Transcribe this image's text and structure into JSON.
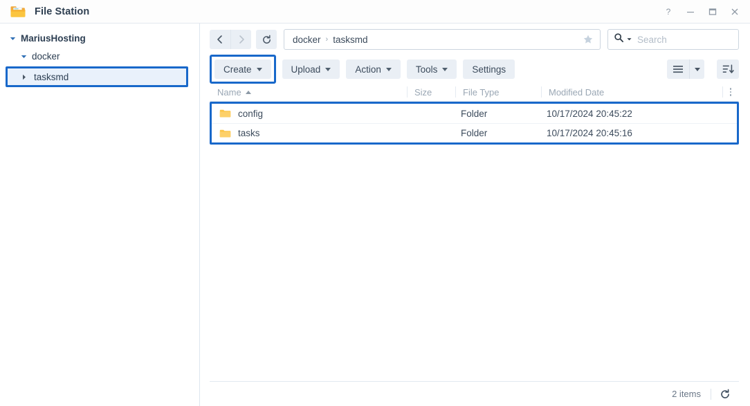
{
  "window": {
    "title": "File Station",
    "icon": "folder-icon",
    "controls": [
      {
        "name": "help-button",
        "glyph": "?"
      },
      {
        "name": "minimize-button",
        "glyph": "—"
      },
      {
        "name": "maximize-button",
        "glyph": "☐"
      },
      {
        "name": "close-button",
        "glyph": "✕"
      }
    ]
  },
  "sidebar": {
    "items": [
      {
        "label": "MariusHosting",
        "level": 0,
        "expanded": true,
        "selected": false
      },
      {
        "label": "docker",
        "level": 1,
        "expanded": true,
        "selected": false
      },
      {
        "label": "tasksmd",
        "level": 2,
        "expanded": false,
        "selected": true
      }
    ]
  },
  "navbar": {
    "back_label": "Back",
    "forward_label": "Forward",
    "refresh_label": "Refresh",
    "favorite_label": "Add to favorites",
    "breadcrumbs": [
      "docker",
      "tasksmd"
    ],
    "breadcrumb_separator": "›",
    "search": {
      "placeholder": "Search",
      "value": ""
    }
  },
  "toolbar": {
    "buttons": [
      {
        "label": "Create",
        "dropdown": true,
        "highlighted": true
      },
      {
        "label": "Upload",
        "dropdown": true,
        "highlighted": false
      },
      {
        "label": "Action",
        "dropdown": true,
        "highlighted": false
      },
      {
        "label": "Tools",
        "dropdown": true,
        "highlighted": false
      },
      {
        "label": "Settings",
        "dropdown": false,
        "highlighted": false
      }
    ],
    "view_button_label": "List view",
    "view_dropdown_label": "View options",
    "sort_button_label": "Sort order"
  },
  "filelist": {
    "columns": [
      {
        "key": "name",
        "label": "Name",
        "sort": "asc"
      },
      {
        "key": "size",
        "label": "Size",
        "sort": ""
      },
      {
        "key": "type",
        "label": "File Type",
        "sort": ""
      },
      {
        "key": "date",
        "label": "Modified Date",
        "sort": ""
      }
    ],
    "column_options_label": "Column options",
    "rows": [
      {
        "name": "config",
        "size": "",
        "type": "Folder",
        "date": "10/17/2024 20:45:22",
        "icon": "folder-icon"
      },
      {
        "name": "tasks",
        "size": "",
        "type": "Folder",
        "date": "10/17/2024 20:45:16",
        "icon": "folder-icon"
      }
    ],
    "highlighted": true
  },
  "statusbar": {
    "count_label": "2 items",
    "refresh_label": "Refresh"
  },
  "colors": {
    "annotation": "#1868ca",
    "accent": "#2f6fb5",
    "folder": "#f6c149",
    "toolbar_button": "#eaeff5",
    "text": "#3c4b5c",
    "muted": "#9aa7b4"
  }
}
